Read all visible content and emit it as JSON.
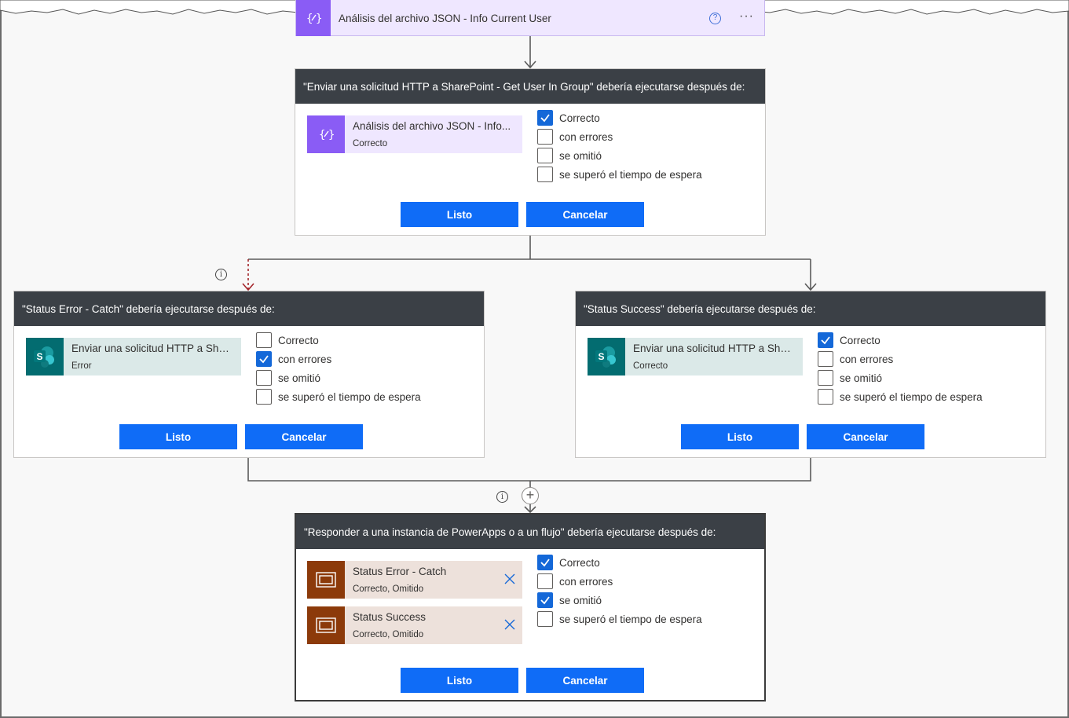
{
  "top_action": {
    "title": "Análisis del archivo JSON - Info Current User",
    "help": "?",
    "more": "···"
  },
  "card1": {
    "header": "\"Enviar una solicitud HTTP a SharePoint - Get User In Group\" debería ejecutarse después de:",
    "action": {
      "name": "Análisis del archivo JSON - Info...",
      "status": "Correcto",
      "icon": "json-parse-icon"
    },
    "options": [
      {
        "label": "Correcto",
        "checked": true
      },
      {
        "label": "con errores",
        "checked": false
      },
      {
        "label": "se omitió",
        "checked": false
      },
      {
        "label": "se superó el tiempo de espera",
        "checked": false
      }
    ],
    "done_label": "Listo",
    "cancel_label": "Cancelar"
  },
  "card2": {
    "header": "\"Status Error - Catch\" debería ejecutarse después de:",
    "action": {
      "name": "Enviar una solicitud HTTP a Sha...",
      "status": "Error",
      "icon": "sharepoint-icon"
    },
    "options": [
      {
        "label": "Correcto",
        "checked": false
      },
      {
        "label": "con errores",
        "checked": true
      },
      {
        "label": "se omitió",
        "checked": false
      },
      {
        "label": "se superó el tiempo de espera",
        "checked": false
      }
    ],
    "done_label": "Listo",
    "cancel_label": "Cancelar"
  },
  "card3": {
    "header": "\"Status Success\" debería ejecutarse después de:",
    "action": {
      "name": "Enviar una solicitud HTTP a Sha...",
      "status": "Correcto",
      "icon": "sharepoint-icon"
    },
    "options": [
      {
        "label": "Correcto",
        "checked": true
      },
      {
        "label": "con errores",
        "checked": false
      },
      {
        "label": "se omitió",
        "checked": false
      },
      {
        "label": "se superó el tiempo de espera",
        "checked": false
      }
    ],
    "done_label": "Listo",
    "cancel_label": "Cancelar"
  },
  "card4": {
    "header": "\"Responder a una instancia de PowerApps o a un flujo\" debería ejecutarse después de:",
    "actions": [
      {
        "name": "Status Error - Catch",
        "status": "Correcto, Omitido",
        "icon": "scope-icon"
      },
      {
        "name": "Status Success",
        "status": "Correcto, Omitido",
        "icon": "scope-icon"
      }
    ],
    "options": [
      {
        "label": "Correcto",
        "checked": true
      },
      {
        "label": "con errores",
        "checked": false
      },
      {
        "label": "se omitió",
        "checked": true
      },
      {
        "label": "se superó el tiempo de espera",
        "checked": false
      }
    ],
    "done_label": "Listo",
    "cancel_label": "Cancelar"
  },
  "info_icon": "i",
  "add_icon": "+",
  "colors": {
    "header_bg": "#3b4046",
    "button_blue": "#0f6cf7",
    "checkbox_blue": "#1468d8",
    "json_purple": "#8a5cf5",
    "sharepoint_teal": "#036c70",
    "scope_brown": "#8c3a0a",
    "error_arrow": "#a4262c"
  }
}
